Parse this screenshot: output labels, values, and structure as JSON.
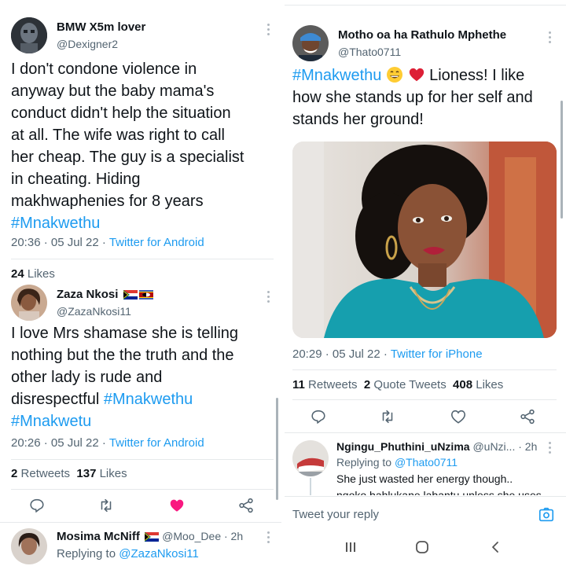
{
  "left": {
    "tweet1": {
      "name": "BMW X5m lover",
      "handle": "@Dexigner2",
      "text_lines": [
        "I don't condone violence in",
        "anyway but the baby mama's",
        "conduct didn't help the situation",
        "at all. The wife was right to call",
        "her cheap. The guy is a specialist",
        "in cheating. Hiding",
        "makhwaphenies for 8 years"
      ],
      "hashtag": "#Mnakwethu",
      "time_date": "20:36 · 05 Jul 22 · ",
      "source": "Twitter for Android"
    },
    "likes_row": {
      "count": "24",
      "label": "Likes"
    },
    "tweet2": {
      "name": "Zaza Nkosi",
      "handle": "@ZazaNkosi11",
      "text_lines": [
        "I love Mrs shamase she is telling",
        "nothing but the the truth and the",
        "other lady is rude and"
      ],
      "text_last_prefix": "disrespectful ",
      "hashtag1": "#Mnakwethu",
      "hashtag2": "#Mnakwetu",
      "time_date": "20:26 · 05 Jul 22 · ",
      "source": "Twitter for Android",
      "retweets_count": "2",
      "retweets_label": "Retweets",
      "likes_count": "137",
      "likes_label": "Likes"
    },
    "reply": {
      "name": "Mosima McNiff",
      "handle_time": "@Moo_Dee · 2h",
      "replying_prefix": "Replying to ",
      "replying_handle": "@ZazaNkosi11"
    }
  },
  "right": {
    "tweet": {
      "name": "Motho oa ha Rathulo Mphethe",
      "handle": "@Thato0711",
      "hashtag": "#Mnakwethu",
      "line1_rest": "Lioness! I like",
      "line2": "how she stands up for her self and",
      "line3": "stands her ground!",
      "time_date": "20:29 · 05 Jul 22 · ",
      "source": "Twitter for iPhone",
      "retweets_count": "11",
      "retweets_label": "Retweets",
      "quotes_count": "2",
      "quotes_label": "Quote Tweets",
      "likes_count": "408",
      "likes_label": "Likes"
    },
    "reply": {
      "name": "Ngingu_Phuthini_uNzima",
      "handle_time": "@uNzi... · 2h",
      "replying_prefix": "Replying to ",
      "replying_handle": "@Thato0711",
      "text": "She just wasted her energy though..",
      "text2": "ngoko bahlukane labantu unless she uses"
    },
    "compose": {
      "placeholder": "Tweet your reply"
    }
  },
  "colors": {
    "accent": "#1d9bf0",
    "like_active": "#f91880",
    "text": "#0f1419",
    "secondary": "#536471"
  }
}
